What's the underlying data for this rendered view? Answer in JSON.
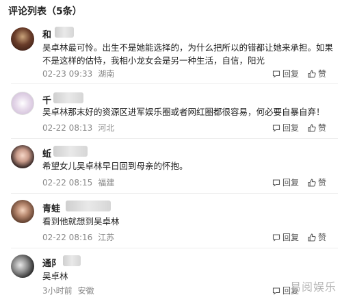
{
  "header": {
    "title": "评论列表（5条）"
  },
  "actions": {
    "reply": "回复",
    "like": "赞"
  },
  "comments": [
    {
      "name": "和",
      "text": "吴卓林最可怜。出生不是她能选择的，为什么把所以的错都让她来承担。如果不是这样的估恃，我相小龙女会是另一种生活，自信，阳光",
      "time": "02-23 09:33",
      "location": "湖南"
    },
    {
      "name": "千",
      "text": "吴卓林那末好的资源区进军娱乐圈或者网红圈都很容易，何必要自暴自弃！",
      "time": "02-22 08:13",
      "location": "河北"
    },
    {
      "name": "蚯",
      "text": "希望女儿吴卓林早日回到母亲的怀抱。",
      "time": "02-22 08:15",
      "location": "福建"
    },
    {
      "name": "青蛙",
      "text": "看到他就想到吴卓林",
      "time": "02-22 08:16",
      "location": "江苏"
    },
    {
      "name": "通阝",
      "text": "吴卓林",
      "time": "3小时前",
      "location": "安徽"
    }
  ],
  "watermark": "易阅娱乐"
}
